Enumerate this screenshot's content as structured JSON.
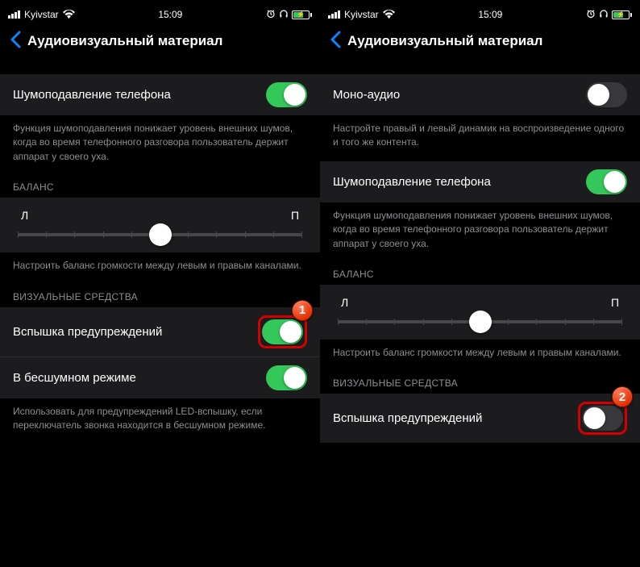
{
  "status": {
    "carrier": "Kyivstar",
    "time": "15:09"
  },
  "nav": {
    "title": "Аудиовизуальный материал"
  },
  "left": {
    "noise": {
      "label": "Шумоподавление телефона",
      "footer": "Функция шумоподавления понижает уровень внешних шумов, когда во время телефонного разговора пользователь держит аппарат у своего уха."
    },
    "balance": {
      "title": "БАЛАНС",
      "left_label": "Л",
      "right_label": "П",
      "value": 50,
      "footer": "Настроить баланс громкости между левым и правым каналами."
    },
    "visual": {
      "title": "ВИЗУАЛЬНЫЕ СРЕДСТВА",
      "flash_label": "Вспышка предупреждений",
      "silent_label": "В бесшумном режиме",
      "footer": "Использовать для предупреждений LED-вспышку, если переключатель звонка находится в бесшумном режиме."
    },
    "badge": "1"
  },
  "right": {
    "mono": {
      "label": "Моно-аудио",
      "footer": "Настройте правый и левый динамик на воспроизведение одного и того же контента."
    },
    "noise": {
      "label": "Шумоподавление телефона",
      "footer": "Функция шумоподавления понижает уровень внешних шумов, когда во время телефонного разговора пользователь держит аппарат у своего уха."
    },
    "balance": {
      "title": "БАЛАНС",
      "left_label": "Л",
      "right_label": "П",
      "value": 50,
      "footer": "Настроить баланс громкости между левым и правым каналами."
    },
    "visual": {
      "title": "ВИЗУАЛЬНЫЕ СРЕДСТВА",
      "flash_label": "Вспышка предупреждений"
    },
    "badge": "2"
  }
}
